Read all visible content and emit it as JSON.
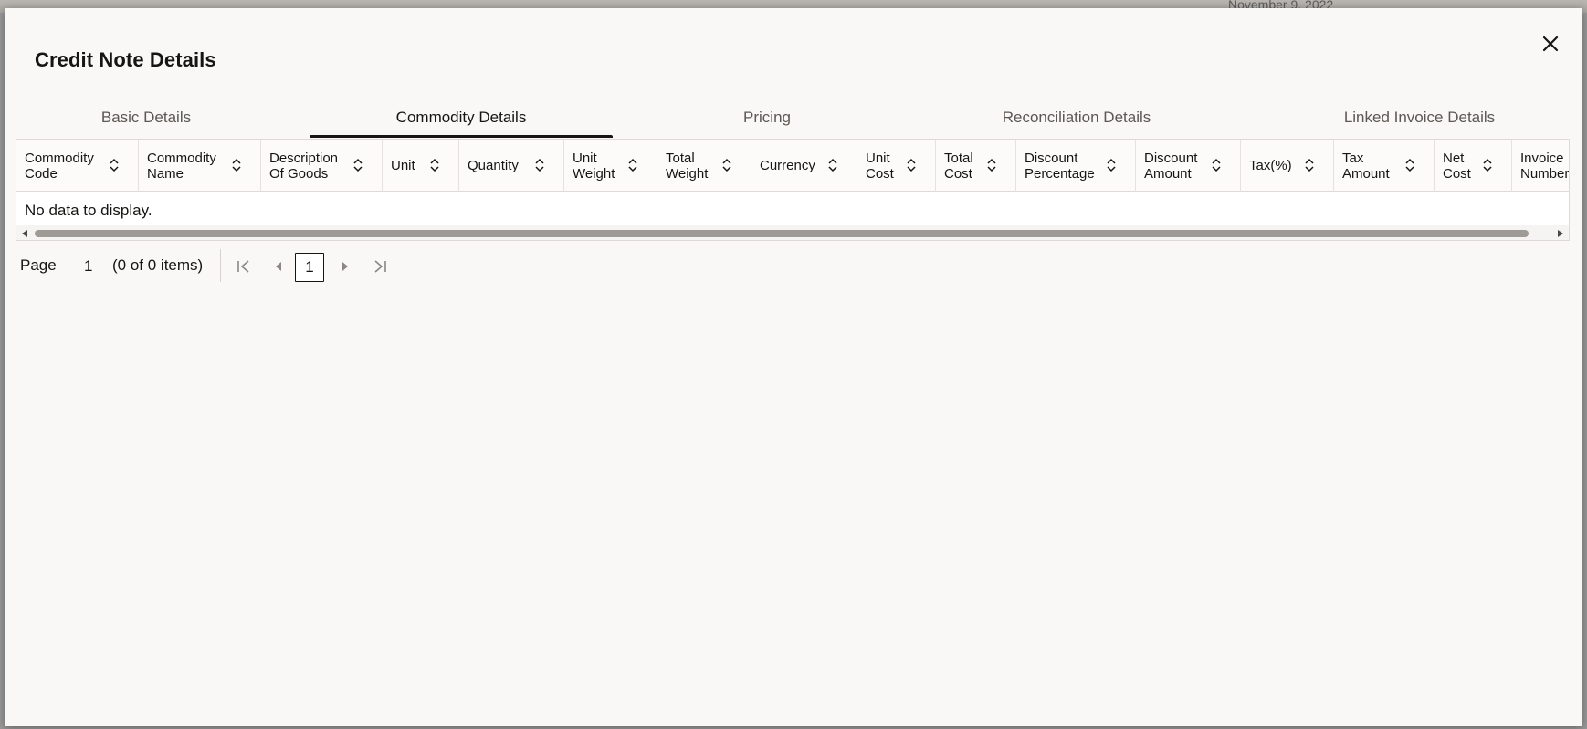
{
  "dialog": {
    "title": "Credit Note Details",
    "close_icon": "close-icon"
  },
  "tabs": [
    {
      "label": "Basic Details",
      "active": false
    },
    {
      "label": "Commodity Details",
      "active": true
    },
    {
      "label": "Pricing",
      "active": false
    },
    {
      "label": "Reconciliation Details",
      "active": false
    },
    {
      "label": "Linked Invoice Details",
      "active": false
    }
  ],
  "table": {
    "columns": [
      "Commodity\nCode",
      "Commodity\nName",
      "Description\nOf Goods",
      "Unit",
      "Quantity",
      "Unit\nWeight",
      "Total\nWeight",
      "Currency",
      "Unit\nCost",
      "Total\nCost",
      "Discount\nPercentage",
      "Discount\nAmount",
      "Tax(%)",
      "Tax\nAmount",
      "Net\nCost",
      "Invoice\nNumber"
    ],
    "empty_message": "No data to display."
  },
  "pagination": {
    "page_label": "Page",
    "current_page": "1",
    "summary": "(0 of 0 items)",
    "page_button": "1"
  },
  "background": {
    "date_fragment": "November 9, 2022"
  },
  "colors": {
    "dialog_bg": "#f9f8f6",
    "text": "#161513",
    "tab_inactive": "#5c5853"
  }
}
